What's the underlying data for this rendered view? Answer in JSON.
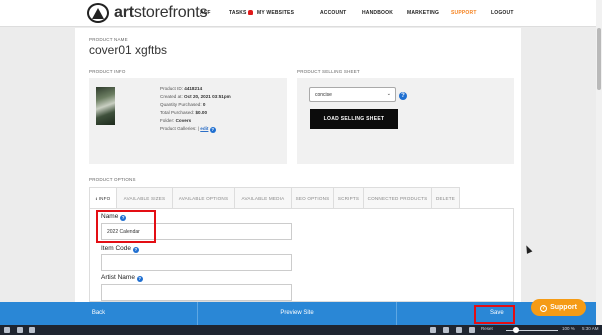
{
  "brand": {
    "bold": "art",
    "rest": "storefronts"
  },
  "nav": [
    {
      "label": "ASF"
    },
    {
      "label": "TASKS"
    },
    {
      "label": "MY WEBSITES"
    },
    {
      "label": "ACCOUNT"
    },
    {
      "label": "HANDBOOK"
    },
    {
      "label": "MARKETING"
    },
    {
      "label": "SUPPORT",
      "active": true
    },
    {
      "label": "LOGOUT"
    }
  ],
  "product": {
    "name_label": "PRODUCT NAME",
    "name": "cover01 xgftbs",
    "info_label": "PRODUCT INFO",
    "id_label": "Product ID:",
    "id_value": "4418214",
    "created_label": "Created at:",
    "created_value": "Oct 20, 2021 03:51pm",
    "qty_label": "Quantity Purchased:",
    "qty_value": "0",
    "total_label": "Total Purchased:",
    "total_value": "$0.00",
    "folder_label": "Folder:",
    "folder_value": "Covers",
    "galleries_label": "Product Galleries: |",
    "galleries_link": "edit"
  },
  "selling_sheet": {
    "label": "PRODUCT SELLING SHEET",
    "selected": "concise",
    "button": "LOAD SELLING SHEET"
  },
  "options": {
    "label": "PRODUCT OPTIONS",
    "tabs": [
      "INFO",
      "AVAILABLE SIZES",
      "AVAILABLE OPTIONS",
      "AVAILABLE MEDIA",
      "SEO OPTIONS",
      "SCRIPTS",
      "CONNECTED PRODUCTS",
      "DELETE"
    ]
  },
  "fields": {
    "name_label": "Name",
    "name_value": "2022 Calendar",
    "item_code_label": "Item Code",
    "artist_label": "Artist Name"
  },
  "bottombar": {
    "back": "Back",
    "preview": "Preview Site",
    "save": "Save",
    "support": "Support"
  },
  "taskbar": {
    "reset": "Reset",
    "zoom": "100 %",
    "time": "5:30 AM"
  },
  "colors": {
    "accent": "#2a87d6",
    "support": "#f59b15",
    "active_nav": "#f5821f",
    "highlight": "#e30e14"
  }
}
